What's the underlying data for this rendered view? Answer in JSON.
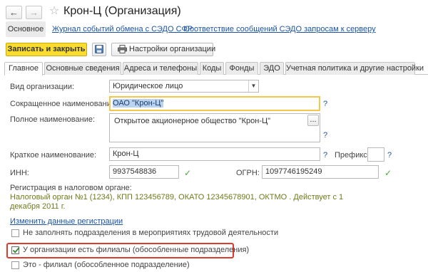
{
  "window": {
    "title": "Крон-Ц (Организация)",
    "back_glyph": "←",
    "forward_glyph": "→",
    "star_glyph": "☆"
  },
  "nav": {
    "main": "Основное",
    "links": [
      "Журнал событий обмена с СЭДО СФР",
      "Соответствие сообщений СЭДО запросам к серверу"
    ]
  },
  "toolbar": {
    "save_close": "Записать и закрыть",
    "settings": "Настройки организации"
  },
  "tabs": [
    "Главное",
    "Основные сведения",
    "Адреса и телефоны",
    "Коды",
    "Фонды",
    "ЭДО",
    "Учетная политика и другие настройки"
  ],
  "form": {
    "org_type": {
      "label": "Вид организации:",
      "value": "Юридическое лицо"
    },
    "short_name": {
      "label": "Сокращенное наименование:",
      "value": "ОАО \"Крон-Ц\""
    },
    "full_name": {
      "label": "Полное наименование:",
      "value": "Открытое акционерное общество \"Крон-Ц\"",
      "button": "..."
    },
    "brief_name": {
      "label": "Краткое наименование:",
      "value": "Крон-Ц"
    },
    "prefix": {
      "label": "Префикс:",
      "value": ""
    },
    "inn": {
      "label": "ИНН:",
      "value": "9937548836"
    },
    "ogrn": {
      "label": "ОГРН:",
      "value": "1097746195249"
    },
    "tax_reg": {
      "label": "Регистрация в налоговом органе:",
      "line1": "Налоговый орган №1 (1234), КПП 123456789, ОКАТО 12345678901, ОКТМО . Действует с 1",
      "line2": "декабря 2011 г."
    },
    "change_reg_link": "Изменить данные регистрации",
    "help_glyph": "?",
    "ok_glyph": "✓",
    "checkboxes": [
      {
        "label": "Не заполнять подразделения в мероприятиях трудовой деятельности",
        "checked": false
      },
      {
        "label": "У организации есть филиалы (обособленные подразделения)",
        "checked": true
      },
      {
        "label": "Это - филиал (обособленное подразделение)",
        "checked": false
      }
    ]
  },
  "colors": {
    "accent_yellow": "#f9dc30",
    "link_blue": "#1b54a4",
    "highlight_red": "#e03a2e",
    "ok_green": "#4caa3d"
  }
}
